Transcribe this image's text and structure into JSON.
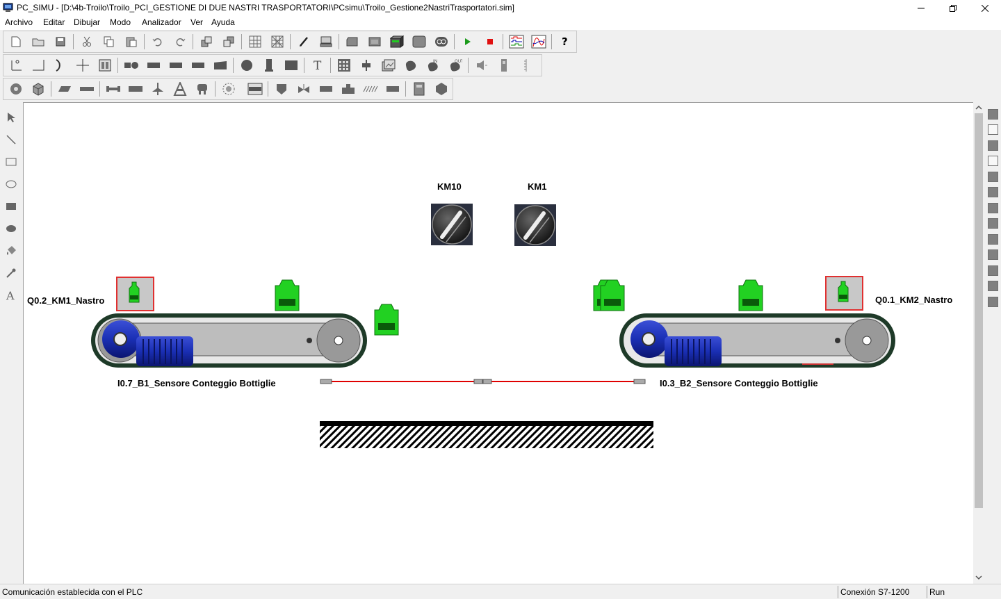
{
  "window": {
    "title": "PC_SIMU - [D:\\4b-Troilo\\Troilo_PCI_GESTIONE DI DUE NASTRI TRASPORTATORI\\PCsimu\\Troilo_Gestione2NastriTrasportatori.sim]"
  },
  "menu": [
    "Archivo",
    "Editar",
    "Dibujar",
    "Modo",
    "Analizador",
    "Ver",
    "Ayuda"
  ],
  "canvas": {
    "selector_km10": "KM10",
    "selector_km1": "KM1",
    "motor_left_label": "Q0.2_KM1_Nastro",
    "motor_right_label": "Q0.1_KM2_Nastro",
    "sensor_left_label": "I0.7_B1_Sensore Conteggio Bottiglie",
    "sensor_right_label": "I0.3_B2_Sensore Conteggio Bottiglie"
  },
  "status": {
    "message": "Comunicación establecida con el PLC",
    "connection": "Conexión S7-1200",
    "mode": "Run"
  },
  "colors": {
    "bottle": "#22d122",
    "lamp_border": "#e03030",
    "motor": "#1a2fb4",
    "belt": "#1e3a28",
    "laser": "#e00000"
  }
}
